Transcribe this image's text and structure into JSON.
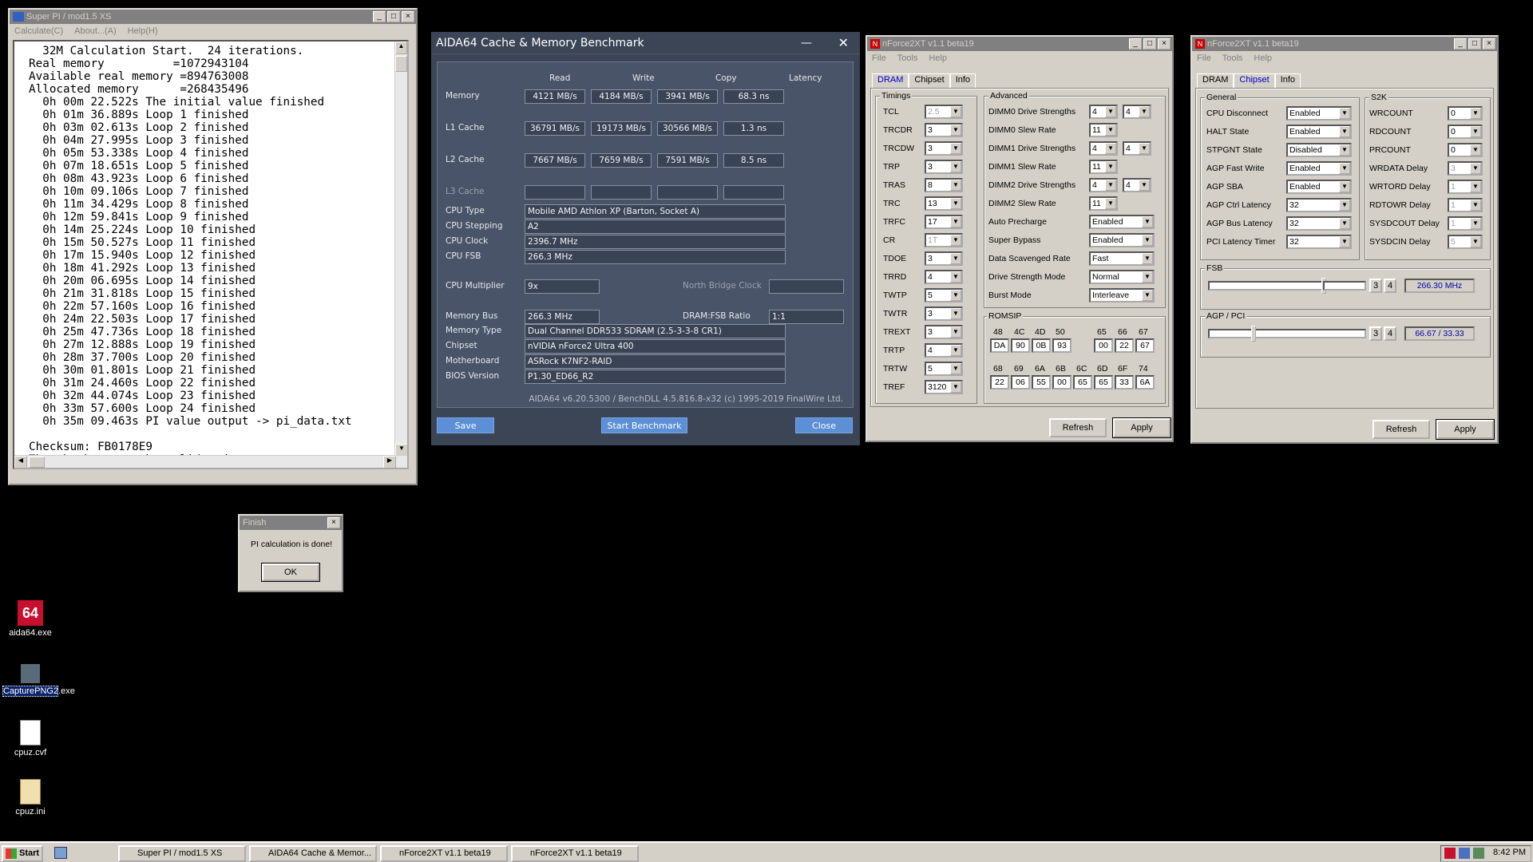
{
  "superpi": {
    "title": "Super PI / mod1.5 XS",
    "menu": [
      "Calculate(C)",
      "About...(A)",
      "Help(H)"
    ],
    "lines": [
      "  32M Calculation Start.  24 iterations.",
      "Real memory          =1072943104",
      "Available real memory =894763008",
      "Allocated memory      =268435496",
      "  0h 00m 22.522s The initial value finished",
      "  0h 01m 36.889s Loop 1 finished",
      "  0h 03m 02.613s Loop 2 finished",
      "  0h 04m 27.995s Loop 3 finished",
      "  0h 05m 53.338s Loop 4 finished",
      "  0h 07m 18.651s Loop 5 finished",
      "  0h 08m 43.923s Loop 6 finished",
      "  0h 10m 09.106s Loop 7 finished",
      "  0h 11m 34.429s Loop 8 finished",
      "  0h 12m 59.841s Loop 9 finished",
      "  0h 14m 25.224s Loop 10 finished",
      "  0h 15m 50.527s Loop 11 finished",
      "  0h 17m 15.940s Loop 12 finished",
      "  0h 18m 41.292s Loop 13 finished",
      "  0h 20m 06.695s Loop 14 finished",
      "  0h 21m 31.818s Loop 15 finished",
      "  0h 22m 57.160s Loop 16 finished",
      "  0h 24m 22.503s Loop 17 finished",
      "  0h 25m 47.736s Loop 18 finished",
      "  0h 27m 12.888s Loop 19 finished",
      "  0h 28m 37.700s Loop 20 finished",
      "  0h 30m 01.801s Loop 21 finished",
      "  0h 31m 24.460s Loop 22 finished",
      "  0h 32m 44.074s Loop 23 finished",
      "  0h 33m 57.600s Loop 24 finished",
      "  0h 35m 09.463s PI value output -> pi_data.txt",
      "",
      "Checksum: FB0178E9",
      "The checksum can be validated at"
    ]
  },
  "finish": {
    "title": "Finish",
    "message": "PI calculation is done!",
    "ok": "OK"
  },
  "aida": {
    "title": "AIDA64 Cache & Memory Benchmark",
    "headers": [
      "Read",
      "Write",
      "Copy",
      "Latency"
    ],
    "rows": [
      {
        "label": "Memory",
        "values": [
          "4121 MB/s",
          "4184 MB/s",
          "3941 MB/s",
          "68.3 ns"
        ]
      },
      {
        "label": "L1 Cache",
        "values": [
          "36791 MB/s",
          "19173 MB/s",
          "30566 MB/s",
          "1.3 ns"
        ]
      },
      {
        "label": "L2 Cache",
        "values": [
          "7667 MB/s",
          "7659 MB/s",
          "7591 MB/s",
          "8.5 ns"
        ]
      },
      {
        "label": "L3 Cache",
        "values": [
          "",
          "",
          "",
          ""
        ]
      }
    ],
    "info": [
      {
        "label": "CPU Type",
        "value": "Mobile AMD Athlon XP  (Barton, Socket A)"
      },
      {
        "label": "CPU Stepping",
        "value": "A2"
      },
      {
        "label": "CPU Clock",
        "value": "2396.7 MHz"
      },
      {
        "label": "CPU FSB",
        "value": "266.3 MHz"
      }
    ],
    "cpu_multiplier_label": "CPU Multiplier",
    "cpu_multiplier": "9x",
    "nb_clock_label": "North Bridge Clock",
    "memory_bus_label": "Memory Bus",
    "memory_bus": "266.3 MHz",
    "dram_fsb_label": "DRAM:FSB Ratio",
    "dram_fsb": "1:1",
    "info2": [
      {
        "label": "Memory Type",
        "value": "Dual Channel DDR533 SDRAM  (2.5-3-3-8 CR1)"
      },
      {
        "label": "Chipset",
        "value": "nVIDIA nForce2 Ultra 400"
      },
      {
        "label": "Motherboard",
        "value": "ASRock K7NF2-RAID"
      },
      {
        "label": "BIOS Version",
        "value": "P1.30_ED66_R2"
      }
    ],
    "footer": "AIDA64 v6.20.5300 / BenchDLL 4.5.816.8-x32  (c) 1995-2019 FinalWire Ltd.",
    "save": "Save",
    "start": "Start Benchmark",
    "close": "Close"
  },
  "nf1": {
    "title": "nForce2XT v1.1 beta19",
    "menu": [
      "File",
      "Tools",
      "Help"
    ],
    "tabs": [
      "DRAM",
      "Chipset",
      "Info"
    ],
    "timings_label": "Timings",
    "timings": [
      {
        "label": "TCL",
        "value": "2.5",
        "disabled": true
      },
      {
        "label": "TRCDR",
        "value": "3"
      },
      {
        "label": "TRCDW",
        "value": "3"
      },
      {
        "label": "TRP",
        "value": "3"
      },
      {
        "label": "TRAS",
        "value": "8"
      },
      {
        "label": "TRC",
        "value": "13"
      },
      {
        "label": "TRFC",
        "value": "17"
      },
      {
        "label": "CR",
        "value": "1T",
        "disabled": true
      },
      {
        "label": "TDOE",
        "value": "3"
      },
      {
        "label": "TRRD",
        "value": "4"
      },
      {
        "label": "TWTP",
        "value": "5"
      },
      {
        "label": "TWTR",
        "value": "3"
      },
      {
        "label": "TREXT",
        "value": "3"
      },
      {
        "label": "TRTP",
        "value": "4"
      },
      {
        "label": "TRTW",
        "value": "5"
      },
      {
        "label": "TREF",
        "value": "3120"
      }
    ],
    "advanced_label": "Advanced",
    "advanced": [
      {
        "label": "DIMM0 Drive Strengths",
        "v1": "4",
        "v2": "4"
      },
      {
        "label": "DIMM0 Slew Rate",
        "v1": "11"
      },
      {
        "label": "DIMM1 Drive Strengths",
        "v1": "4",
        "v2": "4"
      },
      {
        "label": "DIMM1 Slew Rate",
        "v1": "11"
      },
      {
        "label": "DIMM2 Drive Strengths",
        "v1": "4",
        "v2": "4"
      },
      {
        "label": "DIMM2 Slew Rate",
        "v1": "11"
      },
      {
        "label": "Auto Precharge",
        "wide": "Enabled"
      },
      {
        "label": "Super Bypass",
        "wide": "Enabled"
      },
      {
        "label": "Data Scavenged Rate",
        "wide": "Fast"
      },
      {
        "label": "Drive Strength Mode",
        "wide": "Normal"
      },
      {
        "label": "Burst Mode",
        "wide": "Interleave"
      }
    ],
    "romsip_label": "ROMSIP",
    "romsip_row1_heads": [
      "48",
      "4C",
      "4D",
      "50",
      "65",
      "66",
      "67"
    ],
    "romsip_row1_vals": [
      "DA",
      "90",
      "0B",
      "93",
      "00",
      "22",
      "67"
    ],
    "romsip_row2_heads": [
      "68",
      "69",
      "6A",
      "6B",
      "6C",
      "6D",
      "6F",
      "74"
    ],
    "romsip_row2_vals": [
      "22",
      "06",
      "55",
      "00",
      "65",
      "65",
      "33",
      "6A"
    ],
    "refresh": "Refresh",
    "apply": "Apply"
  },
  "nf2": {
    "title": "nForce2XT v1.1 beta19",
    "menu": [
      "File",
      "Tools",
      "Help"
    ],
    "tabs": [
      "DRAM",
      "Chipset",
      "Info"
    ],
    "general_label": "General",
    "general": [
      {
        "label": "CPU Disconnect",
        "value": "Enabled"
      },
      {
        "label": "HALT State",
        "value": "Enabled"
      },
      {
        "label": "STPGNT State",
        "value": "Disabled"
      },
      {
        "label": "AGP Fast Write",
        "value": "Enabled"
      },
      {
        "label": "AGP SBA",
        "value": "Enabled"
      },
      {
        "label": "AGP Ctrl Latency",
        "value": "32"
      },
      {
        "label": "AGP Bus Latency",
        "value": "32"
      },
      {
        "label": "PCI Latency Timer",
        "value": "32"
      }
    ],
    "s2k_label": "S2K",
    "s2k": [
      {
        "label": "WRCOUNT",
        "value": "0"
      },
      {
        "label": "RDCOUNT",
        "value": "0"
      },
      {
        "label": "PRCOUNT",
        "value": "0"
      },
      {
        "label": "WRDATA Delay",
        "value": "3",
        "disabled": true
      },
      {
        "label": "WRTORD Delay",
        "value": "1",
        "disabled": true
      },
      {
        "label": "RDTOWR Delay",
        "value": "1",
        "disabled": true
      },
      {
        "label": "SYSDCOUT Delay",
        "value": "1",
        "disabled": true
      },
      {
        "label": "SYSDCIN Delay",
        "value": "5",
        "disabled": true
      }
    ],
    "fsb_label": "FSB",
    "fsb_value": "266.30 MHz",
    "agp_label": "AGP / PCI",
    "agp_value": "66.67 / 33.33",
    "btn3": "3",
    "btn4": "4",
    "refresh": "Refresh",
    "apply": "Apply"
  },
  "desktop": [
    {
      "label": "aida64.exe"
    },
    {
      "label": "CapturePNG2.exe"
    },
    {
      "label": "cpuz.cvf"
    },
    {
      "label": "cpuz.ini"
    }
  ],
  "taskbar": {
    "start": "Start",
    "items": [
      "Super PI / mod1.5 XS",
      "AIDA64 Cache & Memor...",
      "nForce2XT v1.1 beta19",
      "nForce2XT v1.1 beta19"
    ],
    "clock": "8:42 PM"
  }
}
